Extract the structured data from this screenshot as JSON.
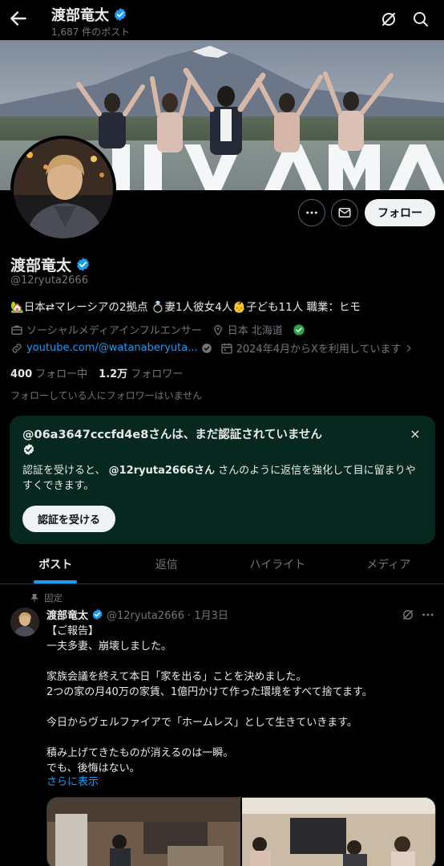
{
  "topbar": {
    "name": "渡部竜太",
    "post_count": "1,687 件のポスト"
  },
  "banner": {
    "sign_text": "LIIYAMA"
  },
  "actions": {
    "follow_label": "フォロー"
  },
  "profile": {
    "name": "渡部竜太",
    "handle": "@12ryuta2666",
    "bio": "🏡日本⇄マレーシアの2拠点 💍妻1人彼女4人👶子ども11人 職業：ヒモ",
    "category": "ソーシャルメディアインフルエンサー",
    "location": "日本 北海道",
    "website": "youtube.com/@watanaberyuta...",
    "joined": "2024年4月からXを利用しています",
    "following_count": "400",
    "following_label": "フォロー中",
    "followers_count": "1.2万",
    "followers_label": "フォロワー",
    "no_mutual": "フォローしている人にフォロワーはいません"
  },
  "verify_card": {
    "title": "@06a3647cccfd4e8さんは、まだ認証されていません",
    "body_prefix": "認証を受けると、",
    "body_handle": "@12ryuta2666さん",
    "body_suffix": " さんのように返信を強化して目に留まりやすくできます。",
    "button": "認証を受ける",
    "close": "×"
  },
  "tabs": [
    {
      "label": "ポスト",
      "active": true
    },
    {
      "label": "返信",
      "active": false
    },
    {
      "label": "ハイライト",
      "active": false
    },
    {
      "label": "メディア",
      "active": false
    }
  ],
  "pinned_post": {
    "pinned_label": "固定",
    "author": "渡部竜太",
    "handle_date": "@12ryuta2666 · 1月3日",
    "lines": [
      "【ご報告】",
      "一夫多妻、崩壊しました。",
      "",
      "家族会議を終えて本日「家を出る」ことを決めました。",
      "2つの家の月40万の家賃、1億円かけて作った環境をすべて捨てます。",
      "",
      "今日からヴェルファイアで「ホームレス」として生きていきます。",
      "",
      "積み上げてきたものが消えるのは一瞬。",
      "でも、後悔はない。"
    ],
    "show_more": "さらに表示"
  },
  "colors": {
    "accent": "#1d9bf0",
    "verified": "#1d9bf0",
    "verify_card_bg": "#06281e",
    "muted": "#71767b"
  }
}
